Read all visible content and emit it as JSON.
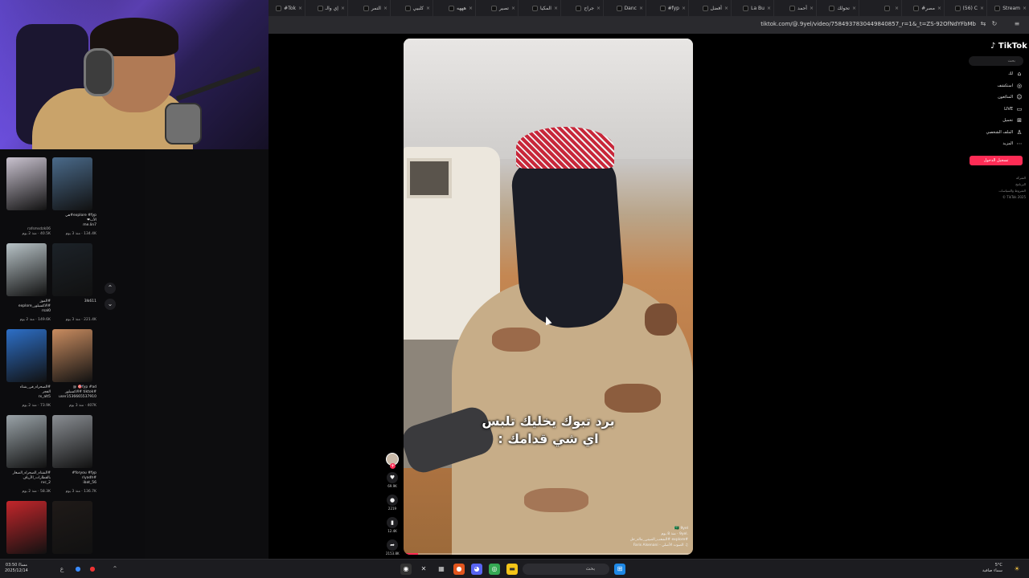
{
  "browser": {
    "tabs": [
      {
        "label": "Stream",
        "icon": "stream-icon"
      },
      {
        "label": "(56) C",
        "icon": "youtube-icon"
      },
      {
        "label": "#مصر",
        "icon": "tiktok-icon"
      },
      {
        "label": "",
        "icon": "tiktok-icon"
      },
      {
        "label": "تحولك",
        "icon": "tiktok-icon"
      },
      {
        "label": "أحمد",
        "icon": "tiktok-icon"
      },
      {
        "label": "La Bu",
        "icon": "tiktok-icon"
      },
      {
        "label": "أفضل",
        "icon": "tiktok-icon"
      },
      {
        "label": "#fyp",
        "icon": "tiktok-icon"
      },
      {
        "label": "Danc",
        "icon": "tiktok-icon"
      },
      {
        "label": "جراح",
        "icon": "tiktok-icon"
      },
      {
        "label": "المكيا",
        "icon": "tiktok-icon"
      },
      {
        "label": "تصير",
        "icon": "tiktok-icon"
      },
      {
        "label": "هههه",
        "icon": "tiktok-icon"
      },
      {
        "label": "كلبيي",
        "icon": "tiktok-icon"
      },
      {
        "label": "التمر",
        "icon": "tiktok-icon"
      },
      {
        "label": "إي والـ",
        "icon": "tiktok-icon"
      },
      {
        "label": "#Tok",
        "icon": "tiktok-icon"
      }
    ],
    "url": "tiktok.com/@.9yel/video/7584937830449840857_r=1&_t=ZS-92OfNdYFbMb"
  },
  "left_feed": {
    "scroll_up": "⌃",
    "scroll_down": "⌄",
    "items": [
      {
        "caption": "",
        "author": "rafsmsdzk06",
        "meta": "40.5K · منذ 2 يوم",
        "color": "#c9c2cf"
      },
      {
        "caption": "explore #fyp#هي\nالأب❤\nme.lin7",
        "author": "",
        "meta": "134.4K · منذ 3 يوم",
        "color": "#4a6a8a"
      },
      {
        "caption": "#الموز\n#الاكسبلور_explore\nrsal0",
        "author": "",
        "meta": "149.6K · منذ 2 يوم",
        "color": "#b8c3c7"
      },
      {
        "caption": "3lk611",
        "author": "",
        "meta": "221.4K · منذ 3 يوم",
        "color": "#1c2228"
      },
      {
        "caption": "#الصحراء_في_شتاء\nالفجر\nrx_alt5",
        "author": "",
        "meta": "73.9K · منذ 2 يوم",
        "color": "#2d6fc7"
      },
      {
        "caption": "fyp #ad🎯 @\n#tiktok #الاكسبلور\nuser1536665537910",
        "author": "",
        "meta": "407K · منذ 3 يوم",
        "color": "#c98c60"
      },
      {
        "caption": "#الشتاء_الصحراء_الصغار\nبالقطارات_الأرياف\nrvc_2",
        "author": "",
        "meta": "58.3K · منذ 2 يوم",
        "color": "#9aa3a8"
      },
      {
        "caption": "foryou #fyp#\n#riyadh\nibat_56",
        "author": "",
        "meta": "136.7K · منذ 3 يوم",
        "color": "#8a8e93"
      },
      {
        "caption": "",
        "author": "",
        "meta": "",
        "color": "#c3262b"
      },
      {
        "caption": "",
        "author": "",
        "meta": "",
        "color": "#1f1a18"
      }
    ]
  },
  "video": {
    "subtitle": "برد تبوك يخليك تلبس\nاي شي قدامك :",
    "info": "🇸🇦 9yel.\n.9yel · منذ 8 يوم\n#explore #الشعب_الصيني_ماله_حل\n♫ الصوت الأصلي - Faris Alsenani",
    "progress": 0.05
  },
  "actions": {
    "avatar_plus": "+",
    "like_count": "69.9K",
    "comment_count": "2219",
    "save_count": "12.4K",
    "share_count": "2153.8K",
    "like_icon": "heart-icon",
    "comment_icon": "comment-icon",
    "save_icon": "bookmark-icon",
    "share_icon": "share-icon"
  },
  "tiktok_nav": {
    "logo": "TikTok",
    "search_placeholder": "بحث",
    "items": [
      {
        "label": "لك",
        "icon": "home-icon"
      },
      {
        "label": "استكشف",
        "icon": "compass-icon"
      },
      {
        "label": "المتابَعون",
        "icon": "user-icon"
      },
      {
        "label": "LIVE",
        "icon": "live-icon"
      },
      {
        "label": "تحميل",
        "icon": "upload-icon"
      },
      {
        "label": "الملف الشخصي",
        "icon": "profile-icon"
      },
      {
        "label": "المزيد",
        "icon": "more-icon"
      }
    ],
    "login": "تسجيل الدخول",
    "footer": "الشركة\nالبرنامج\nالشروط والسياسات\nTikTok 2025 ©"
  },
  "taskbar": {
    "clock": "مساءً 03:50\n2025/12/14",
    "search_text": "بحث",
    "weather": "5°C\nسماء صافية"
  }
}
